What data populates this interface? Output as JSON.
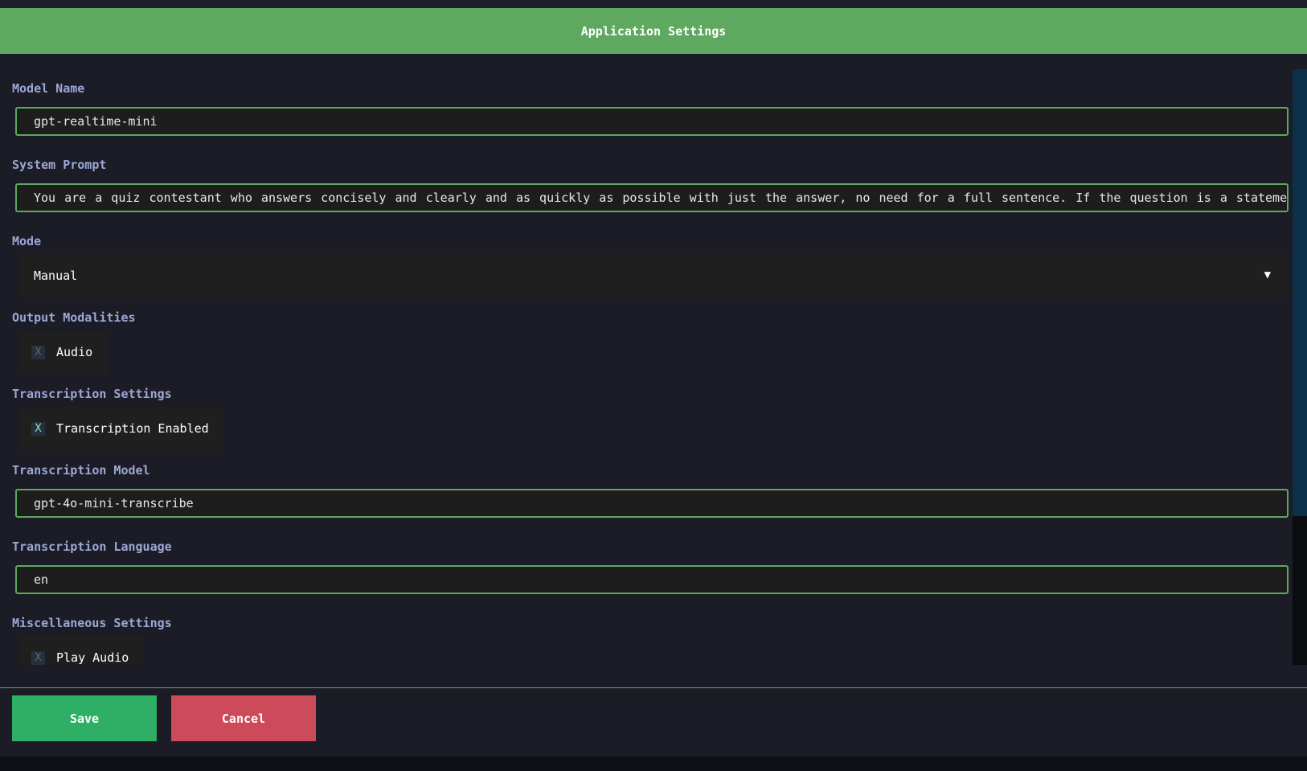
{
  "header": {
    "title": "Application Settings"
  },
  "fields": {
    "model_name": {
      "label": "Model Name",
      "value": "gpt-realtime-mini"
    },
    "system_prompt": {
      "label": "System Prompt",
      "value": "You are a quiz contestant who answers concisely and clearly and as quickly as possible with just the answer, no need for a full sentence. If the question is a statement or"
    },
    "mode": {
      "label": "Mode",
      "value": "Manual",
      "arrow": "▼"
    },
    "output_modalities": {
      "label": "Output Modalities",
      "option": "Audio",
      "mark": "X"
    },
    "transcription_settings": {
      "label": "Transcription Settings",
      "option": "Transcription Enabled",
      "mark": "X"
    },
    "transcription_model": {
      "label": "Transcription Model",
      "value": "gpt-4o-mini-transcribe"
    },
    "transcription_language": {
      "label": "Transcription Language",
      "value": "en"
    },
    "misc": {
      "label": "Miscellaneous Settings",
      "option": "Play Audio",
      "mark": "X"
    }
  },
  "footer": {
    "save_label": "Save",
    "cancel_label": "Cancel"
  },
  "colors": {
    "accent": "#5ea85f",
    "save": "#2fae66",
    "cancel": "#cd4a5b",
    "label": "#9da7d6"
  }
}
